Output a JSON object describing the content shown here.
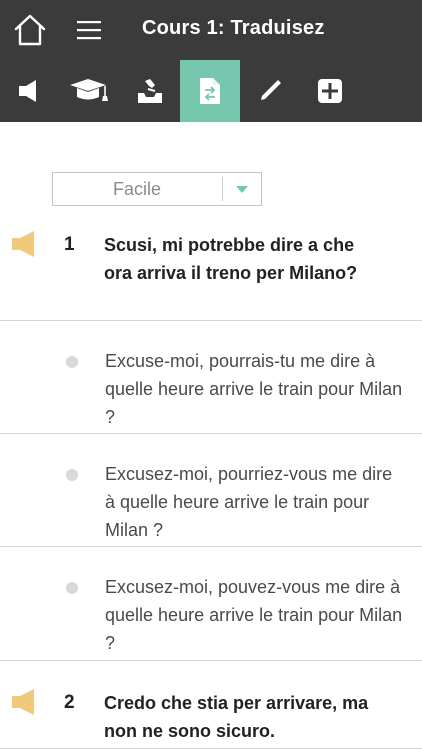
{
  "header": {
    "title": "Cours 1: Traduisez"
  },
  "toolbar": {
    "items": [
      {
        "icon": "speaker-icon"
      },
      {
        "icon": "graduation-cap-icon"
      },
      {
        "icon": "inbox-icon"
      },
      {
        "icon": "translate-document-icon"
      },
      {
        "icon": "pencil-icon"
      },
      {
        "icon": "plus-icon"
      }
    ],
    "active_index": 3
  },
  "level_select": {
    "value": "Facile"
  },
  "questions": [
    {
      "number": "1",
      "text": "Scusi, mi potrebbe dire a che ora arriva il treno per Milano?",
      "options": [
        "Excuse-moi, pourrais-tu me dire à quelle heure arrive le train pour Milan ?",
        "Excusez-moi, pourriez-vous me dire à quelle heure arrive le train pour Milan ?",
        "Excusez-moi, pouvez-vous me dire à quelle heure arrive le train pour Milan ?"
      ]
    },
    {
      "number": "2",
      "text": "Credo che stia per arrivare, ma non ne sono sicuro."
    }
  ],
  "colors": {
    "header_bg": "#3b3b3b",
    "active_tab": "#76c6ad",
    "speaker": "#f0c97a",
    "dot": "#d8d8d8"
  }
}
